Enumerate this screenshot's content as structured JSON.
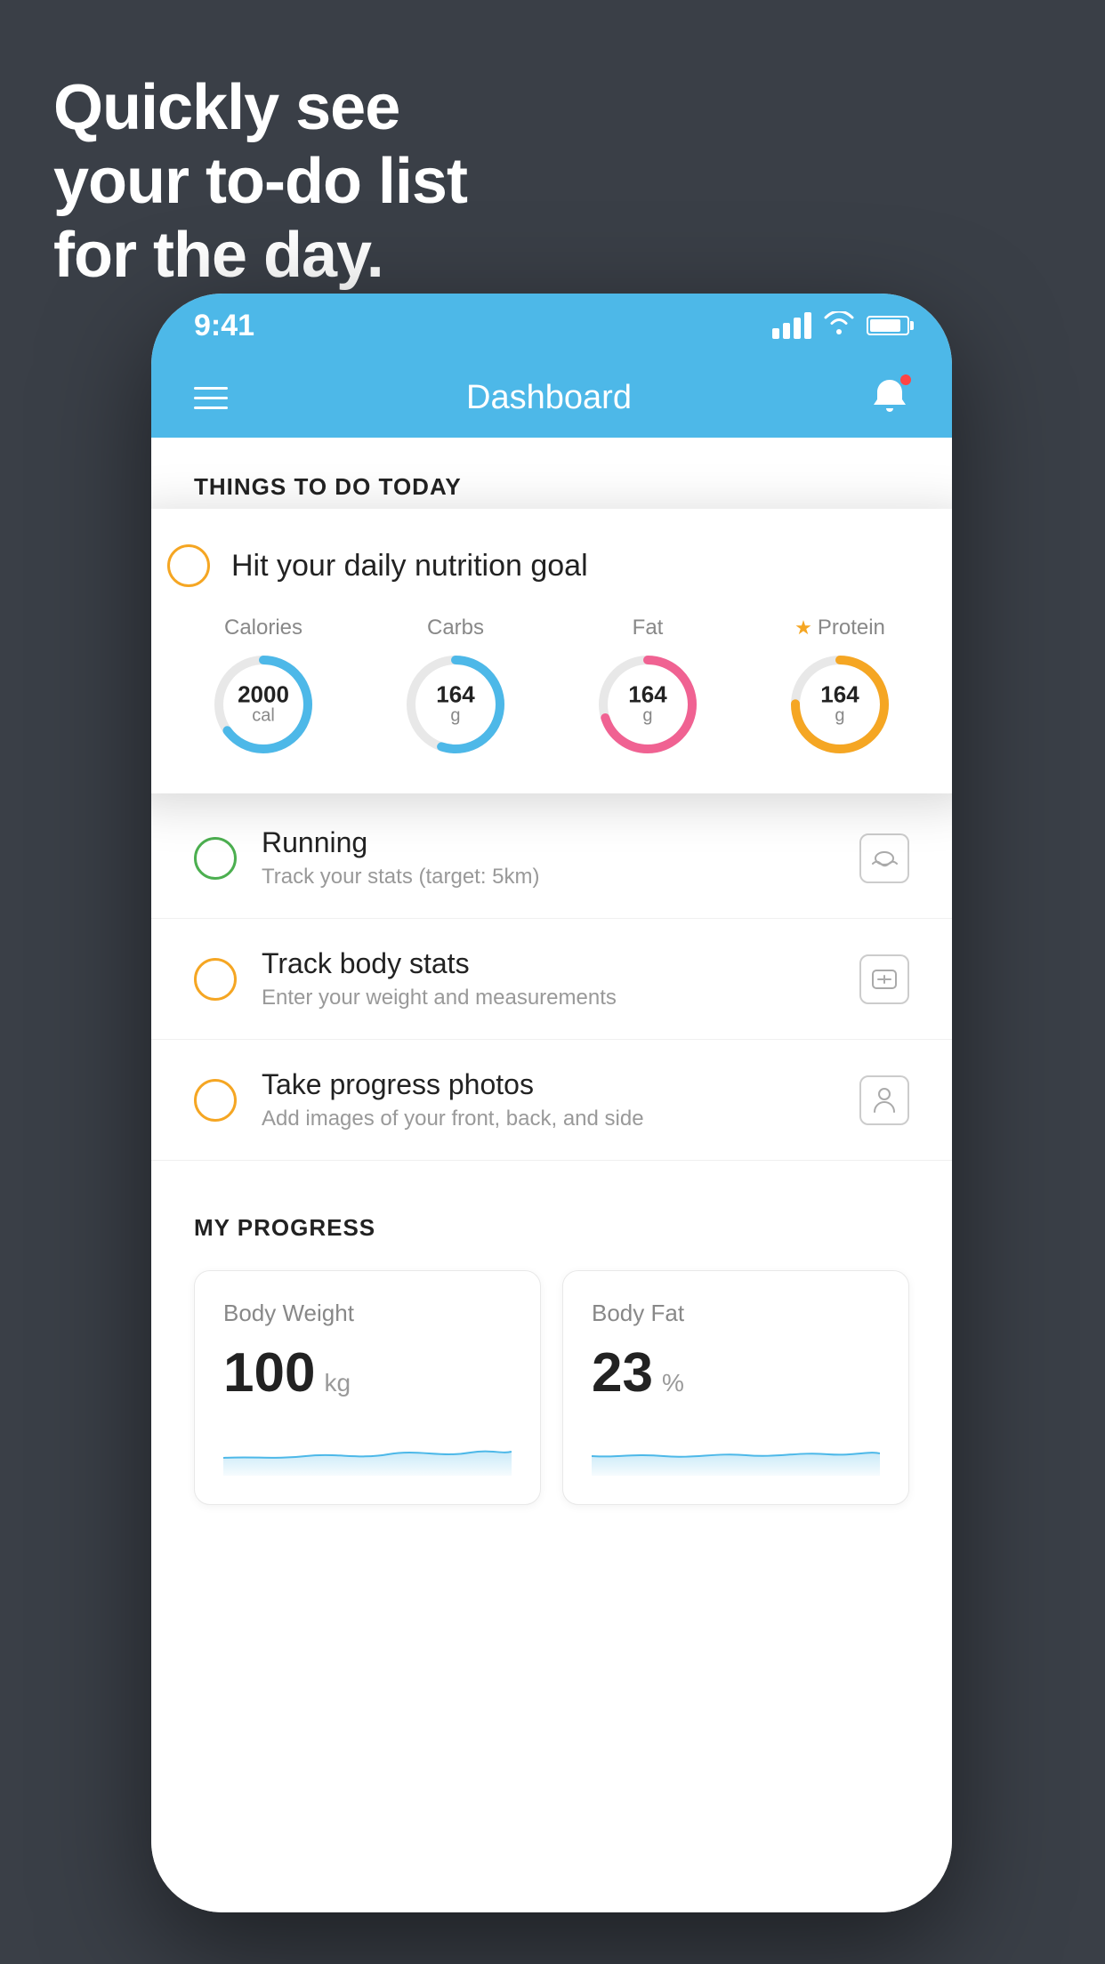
{
  "hero": {
    "line1": "Quickly see",
    "line2": "your to-do list",
    "line3": "for the day."
  },
  "statusBar": {
    "time": "9:41"
  },
  "header": {
    "title": "Dashboard"
  },
  "sectionHeader": "THINGS TO DO TODAY",
  "floatingCard": {
    "checkboxColor": "yellow",
    "title": "Hit your daily nutrition goal",
    "nutrition": [
      {
        "label": "Calories",
        "value": "2000",
        "unit": "cal",
        "color": "blue",
        "percent": 65,
        "star": false
      },
      {
        "label": "Carbs",
        "value": "164",
        "unit": "g",
        "color": "blue",
        "percent": 55,
        "star": false
      },
      {
        "label": "Fat",
        "value": "164",
        "unit": "g",
        "color": "pink",
        "percent": 70,
        "star": false
      },
      {
        "label": "Protein",
        "value": "164",
        "unit": "g",
        "color": "yellow",
        "percent": 75,
        "star": true
      }
    ]
  },
  "todoItems": [
    {
      "title": "Running",
      "subtitle": "Track your stats (target: 5km)",
      "checkColor": "green",
      "icon": "👟"
    },
    {
      "title": "Track body stats",
      "subtitle": "Enter your weight and measurements",
      "checkColor": "yellow",
      "icon": "⚖️"
    },
    {
      "title": "Take progress photos",
      "subtitle": "Add images of your front, back, and side",
      "checkColor": "yellow",
      "icon": "👤"
    }
  ],
  "progressSection": {
    "title": "MY PROGRESS",
    "cards": [
      {
        "title": "Body Weight",
        "value": "100",
        "unit": "kg"
      },
      {
        "title": "Body Fat",
        "value": "23",
        "unit": "%"
      }
    ]
  }
}
